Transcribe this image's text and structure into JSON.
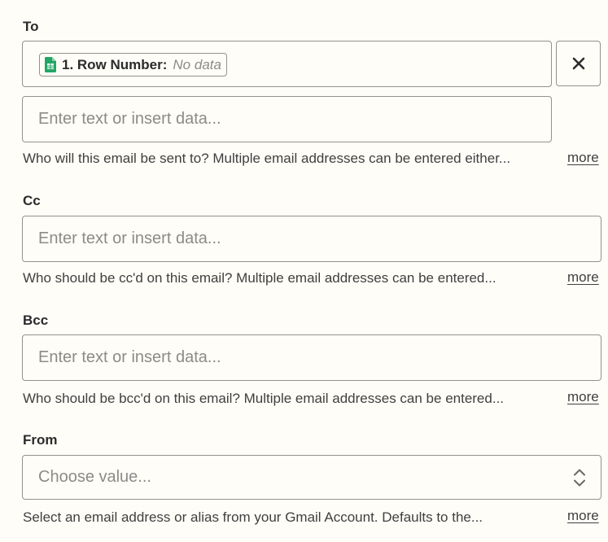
{
  "to": {
    "label": "To",
    "chip": {
      "name": "1. Row Number:",
      "value": "No data",
      "icon": "google-sheets-icon"
    },
    "input_placeholder": "Enter text or insert data...",
    "help": "Who will this email be sent to? Multiple email addresses can be entered either...",
    "more": "more"
  },
  "cc": {
    "label": "Cc",
    "input_placeholder": "Enter text or insert data...",
    "help": "Who should be cc'd on this email? Multiple email addresses can be entered...",
    "more": "more"
  },
  "bcc": {
    "label": "Bcc",
    "input_placeholder": "Enter text or insert data...",
    "help": "Who should be bcc'd on this email? Multiple email addresses can be entered...",
    "more": "more"
  },
  "from": {
    "label": "From",
    "select_placeholder": "Choose value...",
    "help": "Select an email address or alias from your Gmail Account. Defaults to the...",
    "more": "more"
  },
  "colors": {
    "background": "#fffdf8",
    "border": "#95928e",
    "placeholder": "#8e8b87",
    "sheets_green": "#23a566"
  }
}
